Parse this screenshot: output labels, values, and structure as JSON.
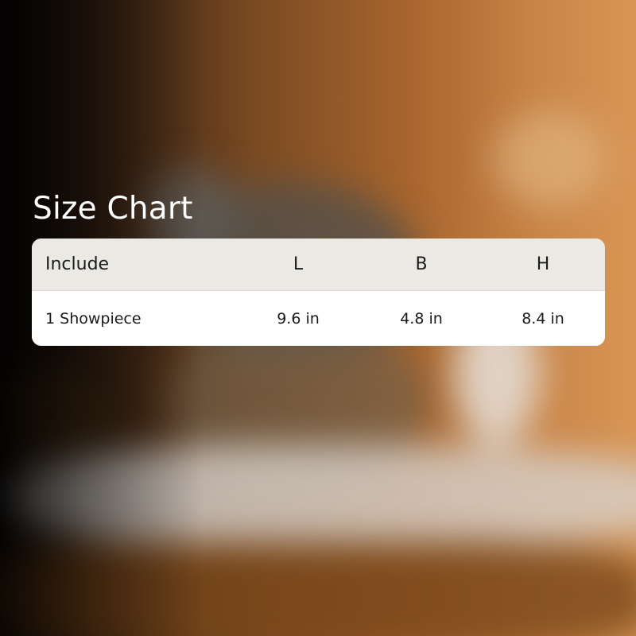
{
  "title": "Size Chart",
  "table": {
    "headers": [
      "Include",
      "L",
      "B",
      "H"
    ],
    "rows": [
      [
        "1 Showpiece",
        "9.6 in",
        "4.8 in",
        "8.4 in"
      ]
    ]
  },
  "colors": {
    "header_bg": "#ebe9e4",
    "body_bg": "#ffffff",
    "text": "#1b1b1b",
    "title": "#ffffff",
    "accent_background": "#c98547"
  }
}
